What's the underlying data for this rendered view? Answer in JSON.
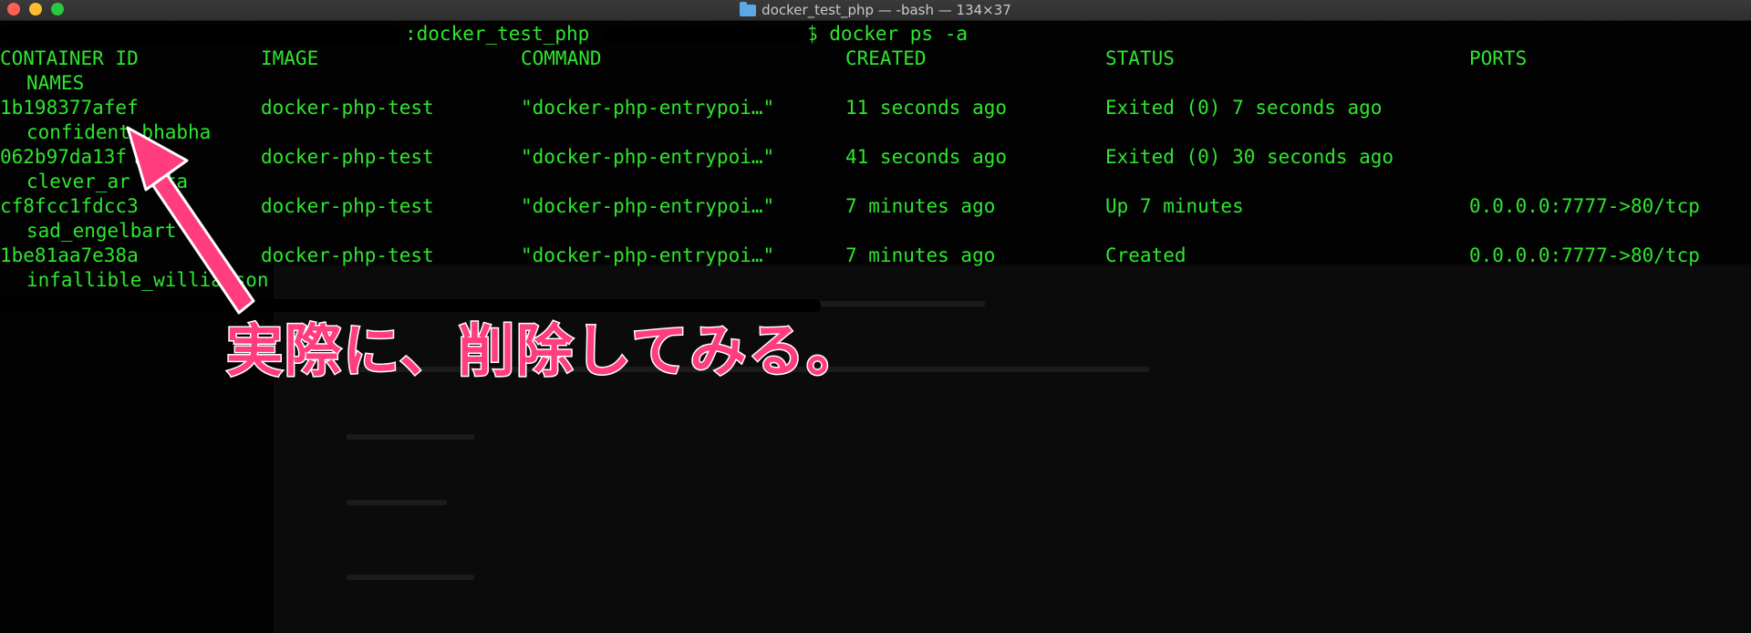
{
  "window": {
    "title": "docker_test_php — -bash — 134×37",
    "folder_icon": "folder-icon"
  },
  "prompt": {
    "visible_text": ":docker_test_php",
    "command": "$ docker ps -a"
  },
  "table": {
    "headers": {
      "container_id": "CONTAINER ID",
      "image": "IMAGE",
      "command": "COMMAND",
      "created": "CREATED",
      "status": "STATUS",
      "ports": "PORTS",
      "names": "NAMES"
    },
    "rows": [
      {
        "container_id": "1b198377afef",
        "image": "docker-php-test",
        "command": "\"docker-php-entrypoi…\"",
        "created": "11 seconds ago",
        "status": "Exited (0) 7 seconds ago",
        "ports": "",
        "name": "confident_bhabha"
      },
      {
        "container_id": "062b97da13f",
        "image": "docker-php-test",
        "command": "\"docker-php-entrypoi…\"",
        "created": "41 seconds ago",
        "status": "Exited (0) 30 seconds ago",
        "ports": "",
        "name": "clever_ar hata"
      },
      {
        "container_id": "cf8fcc1fdcc3",
        "image": "docker-php-test",
        "command": "\"docker-php-entrypoi…\"",
        "created": "7 minutes ago",
        "status": "Up 7 minutes",
        "ports": "0.0.0.0:7777->80/tcp",
        "name": "sad_engelbart"
      },
      {
        "container_id": "1be81aa7e38a",
        "image": "docker-php-test",
        "command": "\"docker-php-entrypoi…\"",
        "created": "7 minutes ago",
        "status": "Created",
        "ports": "0.0.0.0:7777->80/tcp",
        "name": "infallible_williamson"
      }
    ]
  },
  "annotation": {
    "text": "実際に、削除してみる。",
    "color": "#ff3d7f"
  },
  "colors": {
    "terminal_text": "#2ee62e",
    "background": "#020202"
  }
}
